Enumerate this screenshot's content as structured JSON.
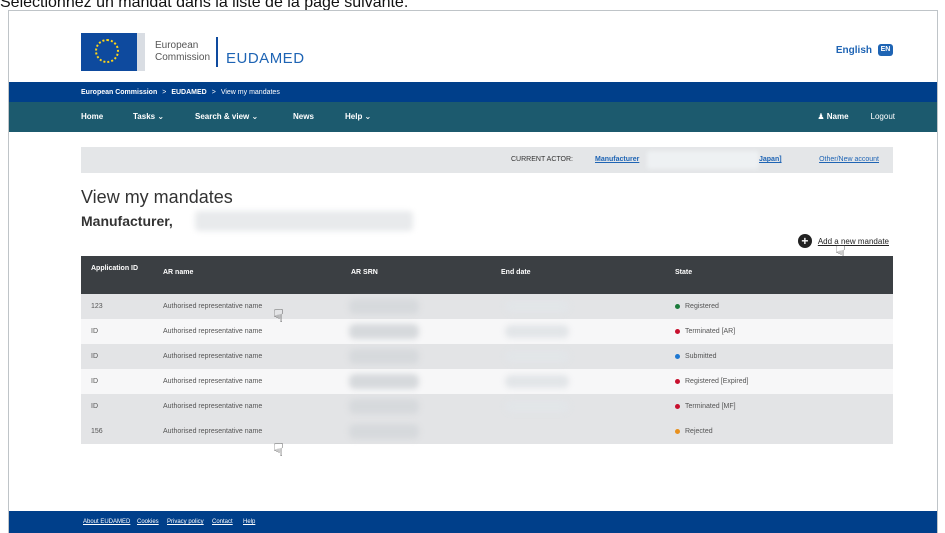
{
  "caption": "Sélectionnez un mandat dans la liste de la page suivante.",
  "header": {
    "ec_line1": "European",
    "ec_line2": "Commission",
    "app_name": "EUDAMED",
    "language": "English"
  },
  "breadcrumb": [
    "European Commission",
    "EUDAMED",
    "View my mandates"
  ],
  "nav": {
    "items": [
      "Home",
      "Tasks ⌄",
      "Search & view ⌄",
      "News",
      "Help ⌄"
    ],
    "user_name": "Name",
    "logout": "Logout"
  },
  "actor": {
    "label": "CURRENT ACTOR:",
    "value_start": "Manufacturer",
    "value_end": "Japan]",
    "other_link": "Other/New account"
  },
  "page": {
    "title": "View my mandates",
    "subtitle": "Manufacturer,",
    "add_link": "Add a new mandate"
  },
  "table": {
    "headers": [
      "Application ID",
      "AR name",
      "AR SRN",
      "End date",
      "State"
    ],
    "rows": [
      {
        "id": "123",
        "name": "Authorised representative name",
        "state": "Registered",
        "color": "#1b7a3a"
      },
      {
        "id": "ID",
        "name": "Authorised representative name",
        "state": "Terminated [AR]",
        "color": "#c8102e"
      },
      {
        "id": "ID",
        "name": "Authorised representative name",
        "state": "Submitted",
        "color": "#1e78d2"
      },
      {
        "id": "ID",
        "name": "Authorised representative name",
        "state": "Registered [Expired]",
        "color": "#c8102e"
      },
      {
        "id": "ID",
        "name": "Authorised representative name",
        "state": "Terminated [MF]",
        "color": "#c8102e"
      },
      {
        "id": "156",
        "name": "Authorised representative name",
        "state": "Rejected",
        "color": "#e8901e"
      }
    ]
  },
  "footer": [
    "About EUDAMED",
    "Cookies",
    "Privacy policy",
    "Contact",
    "Help"
  ]
}
